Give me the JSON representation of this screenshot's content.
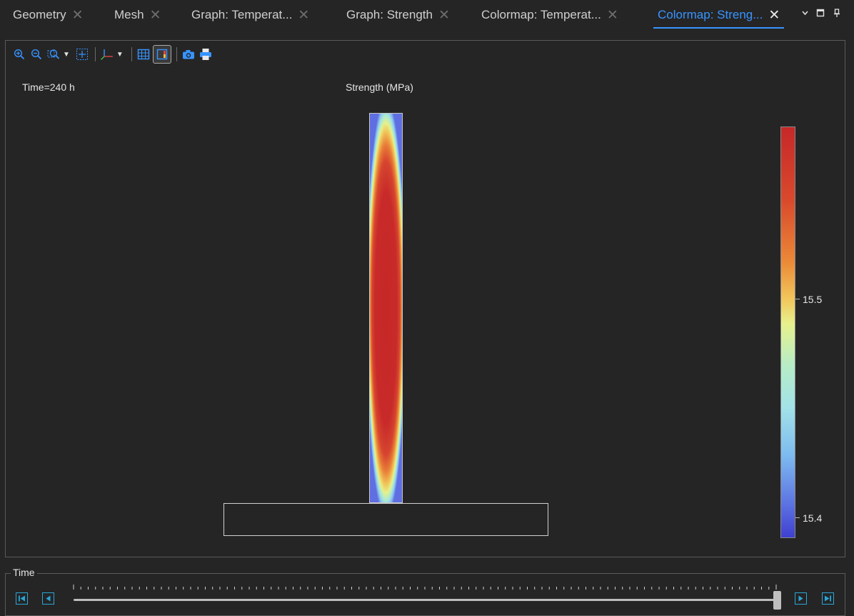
{
  "tabs": [
    {
      "label": "Geometry",
      "active": false
    },
    {
      "label": "Mesh",
      "active": false
    },
    {
      "label": "Graph: Temperat...",
      "active": false
    },
    {
      "label": "Graph: Strength",
      "active": false
    },
    {
      "label": "Colormap: Temperat...",
      "active": false
    },
    {
      "label": "Colormap: Streng...",
      "active": true
    }
  ],
  "tab_close_glyph": "✕",
  "window_controls": [
    "chevron-down-icon",
    "maximize-icon",
    "pin-icon"
  ],
  "toolbar": {
    "buttons": [
      "zoom-in-icon",
      "zoom-out-icon",
      "zoom-box-icon",
      "fit-extents-icon",
      "axes-triad-icon",
      "grid-icon",
      "legend-toggle-icon",
      "camera-icon",
      "print-icon"
    ]
  },
  "plot": {
    "time_label": "Time=240 h",
    "title": "Strength (MPa)"
  },
  "legend": {
    "ticks": [
      {
        "value": 15.5,
        "label": "15.5"
      },
      {
        "value": 15.4,
        "label": "15.4"
      }
    ],
    "colors": [
      "#c62828",
      "#eb8a38",
      "#e7f18d",
      "#a3e3e8",
      "#5c72e2",
      "#3f3fd0"
    ]
  },
  "time_group": {
    "title": "Time",
    "buttons": [
      "first-frame-icon",
      "previous-frame-icon",
      "next-frame-icon",
      "last-frame-icon"
    ],
    "slider_position": 1.0
  },
  "accent_color": "#3794ff",
  "control_color": "#2aa6d6"
}
